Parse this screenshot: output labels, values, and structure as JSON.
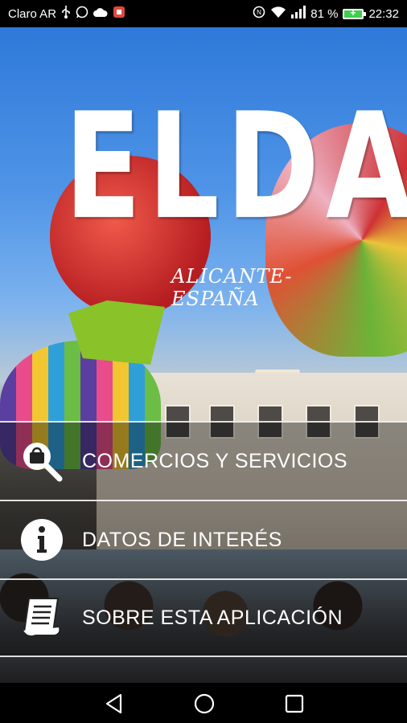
{
  "status_bar": {
    "carrier": "Claro AR",
    "battery_percent": "81 %",
    "time": "22:32",
    "icons": [
      "usb-icon",
      "whatsapp-icon",
      "cloud-icon",
      "app-notification-icon",
      "nfc-icon",
      "wifi-icon",
      "signal-icon",
      "battery-icon"
    ]
  },
  "hero": {
    "title": "ELDA",
    "subtitle": "ALICANTE-ESPAÑA"
  },
  "menu": {
    "items": [
      {
        "label": "COMERCIOS Y SERVICIOS",
        "icon": "search-bag-icon"
      },
      {
        "label": "DATOS DE INTERÉS",
        "icon": "info-icon"
      },
      {
        "label": "SOBRE ESTA APLICACIÓN",
        "icon": "document-icon"
      }
    ]
  },
  "nav_bar": {
    "icons": [
      "back-icon",
      "home-icon",
      "recents-icon"
    ]
  },
  "colors": {
    "sky": "#4f94e7",
    "menu_text": "#ffffff",
    "battery_fill": "#3fcf4f"
  }
}
